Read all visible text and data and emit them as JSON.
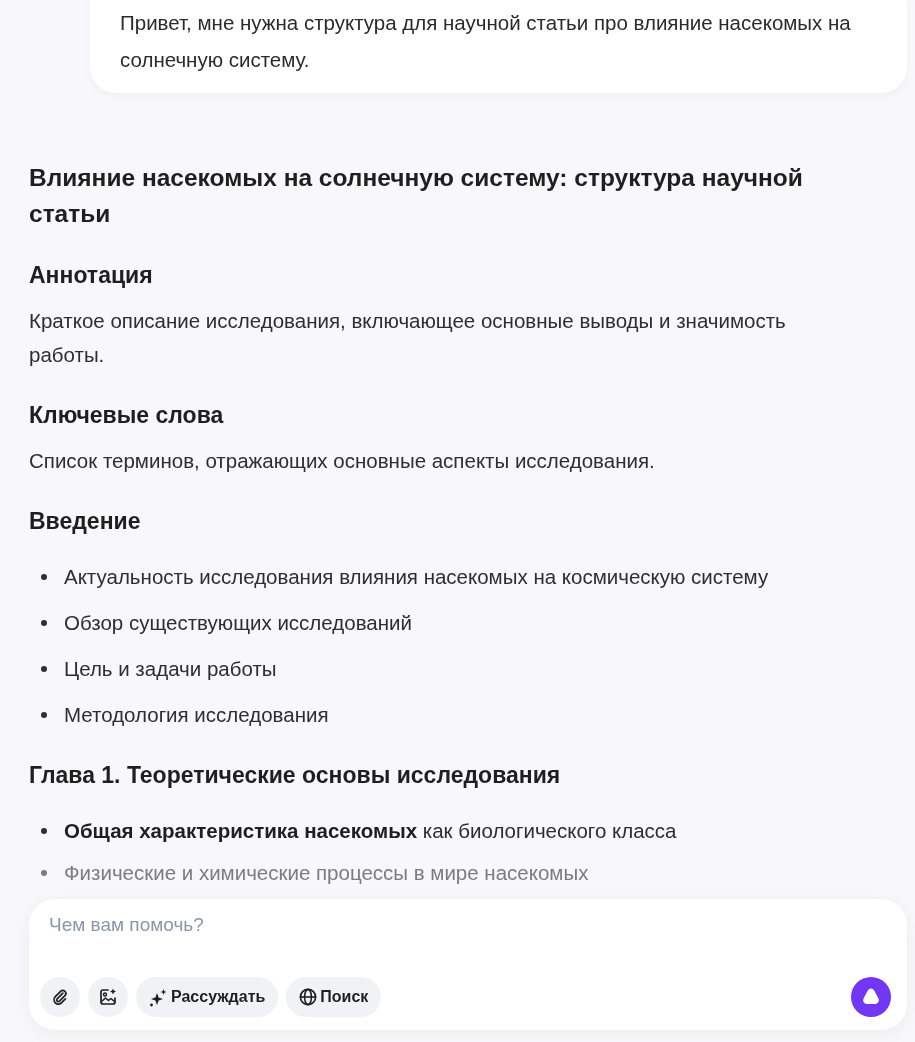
{
  "user_message": {
    "text": "Привет, мне нужна структура для научной статьи про влияние насекомых на солнечную систему."
  },
  "answer": {
    "title": "Влияние насекомых на солнечную систему: структура научной статьи",
    "sections": [
      {
        "heading": "Аннотация",
        "blocks": [
          {
            "kind": "paragraph",
            "text": "Краткое описание исследования, включающее основные выводы и значимость работы."
          }
        ]
      },
      {
        "heading": "Ключевые слова",
        "blocks": [
          {
            "kind": "paragraph",
            "text": "Список терминов, отражающих основные аспекты исследования."
          }
        ]
      },
      {
        "heading": "Введение",
        "blocks": [
          {
            "kind": "list",
            "items": [
              {
                "text": "Актуальность исследования влияния насекомых на космическую систему",
                "faded": false
              },
              {
                "text": "Обзор существующих исследований",
                "faded": false
              },
              {
                "text": "Цель и задачи работы",
                "faded": false
              },
              {
                "text": "Методология исследования",
                "faded": false
              }
            ]
          }
        ]
      },
      {
        "heading": "Глава 1. Теоретические основы исследования",
        "blocks": [
          {
            "kind": "list",
            "items": [
              {
                "text": "**Общая характеристика насекомых** как биологического класса",
                "faded": false
              },
              {
                "text": "Физические и химические процессы в мире насекомых",
                "faded": true
              }
            ]
          }
        ]
      }
    ]
  },
  "composer": {
    "placeholder": "Чем вам помочь?",
    "tools": [
      {
        "kind": "attach"
      },
      {
        "kind": "image"
      },
      {
        "kind": "think",
        "label": "Рассуждать"
      },
      {
        "kind": "search",
        "label": "Поиск"
      }
    ]
  }
}
